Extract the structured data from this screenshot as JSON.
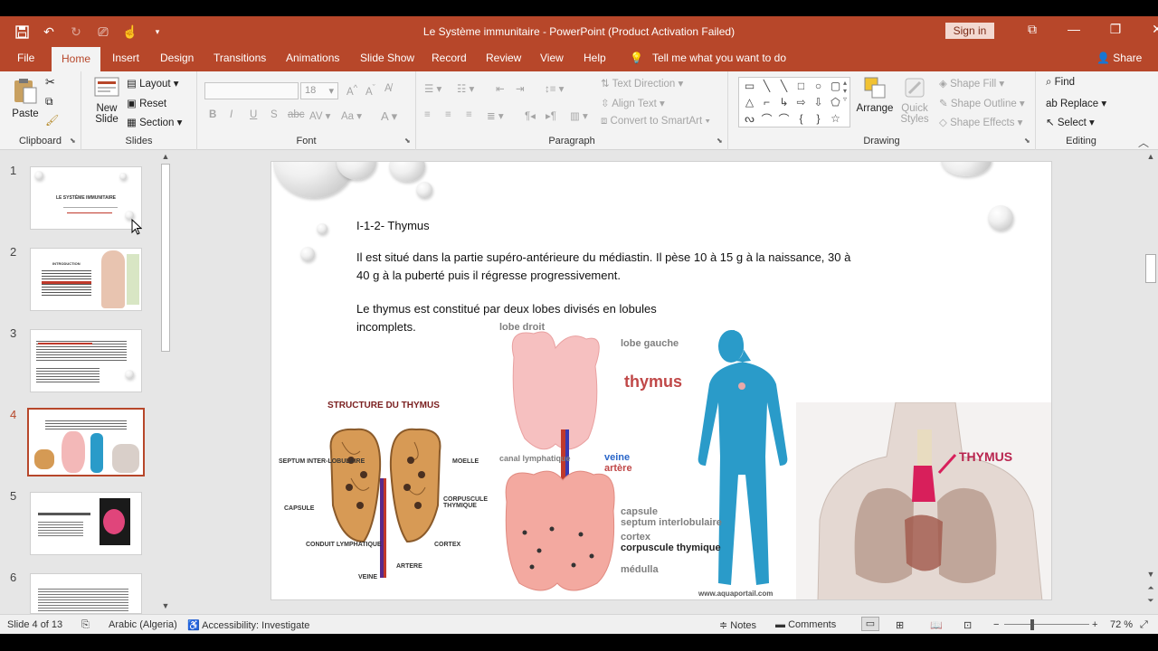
{
  "app": {
    "title": "Le Système immunitaire  -  PowerPoint (Product Activation Failed)",
    "sign_in": "Sign in",
    "tell_me": "Tell me what you want to do",
    "share": "Share"
  },
  "tabs": [
    "File",
    "Home",
    "Insert",
    "Design",
    "Transitions",
    "Animations",
    "Slide Show",
    "Record",
    "Review",
    "View",
    "Help"
  ],
  "active_tab": "Home",
  "ribbon": {
    "clipboard": {
      "paste": "Paste",
      "label": "Clipboard"
    },
    "slides": {
      "new_slide_1": "New",
      "new_slide_2": "Slide",
      "layout": "Layout",
      "reset": "Reset",
      "section": "Section",
      "label": "Slides"
    },
    "font": {
      "size": "18",
      "label": "Font"
    },
    "paragraph": {
      "text_direction": "Text Direction",
      "align_text": "Align Text",
      "convert_smartart": "Convert to SmartArt",
      "label": "Paragraph"
    },
    "drawing": {
      "arrange": "Arrange",
      "quick_styles_1": "Quick",
      "quick_styles_2": "Styles",
      "shape_fill": "Shape Fill",
      "shape_outline": "Shape Outline",
      "shape_effects": "Shape Effects",
      "label": "Drawing"
    },
    "editing": {
      "find": "Find",
      "replace": "Replace",
      "select": "Select",
      "label": "Editing"
    }
  },
  "thumbnails": [
    {
      "num": "1",
      "title": "LE SYSTÈME IMMUNITAIRE"
    },
    {
      "num": "2",
      "title": "INTRODUCTION"
    },
    {
      "num": "3",
      "title": ""
    },
    {
      "num": "4",
      "title": ""
    },
    {
      "num": "5",
      "title": ""
    },
    {
      "num": "6",
      "title": ""
    }
  ],
  "active_thumbnail": 4,
  "slide": {
    "heading": "I-1-2- Thymus",
    "para1_line1": "Il est situé dans la partie supéro-antérieure du médiastin. Il pèse 10 à 15 g à la naissance, 30 à",
    "para1_line2": "40 g à la puberté puis il régresse progressivement.",
    "para2_line1": "Le thymus est constitué par deux lobes divisés en lobules",
    "para2_line2": "incomplets.",
    "figure1": {
      "title": "STRUCTURE DU THYMUS",
      "labels": [
        "SEPTUM INTER-LOBULAIRE",
        "MOELLE",
        "CORPUSCULE THYMIQUE",
        "CAPSULE",
        "CORTEX",
        "CONDUIT LYMPHATIQUE",
        "VEINE",
        "ARTERE"
      ]
    },
    "figure2": {
      "labels": [
        "lobe droit",
        "lobe gauche",
        "thymus",
        "canal lymphatique",
        "veine",
        "artère",
        "capsule",
        "septum interlobulaire",
        "cortex",
        "corpuscule thymique",
        "médulla"
      ],
      "watermark": "www.aquaportail.com"
    },
    "figure3": {
      "label": "THYMUS"
    }
  },
  "status": {
    "slide_of": "Slide 4 of 13",
    "language": "Arabic (Algeria)",
    "accessibility": "Accessibility: Investigate",
    "notes": "Notes",
    "comments": "Comments",
    "zoom": "72 %"
  }
}
